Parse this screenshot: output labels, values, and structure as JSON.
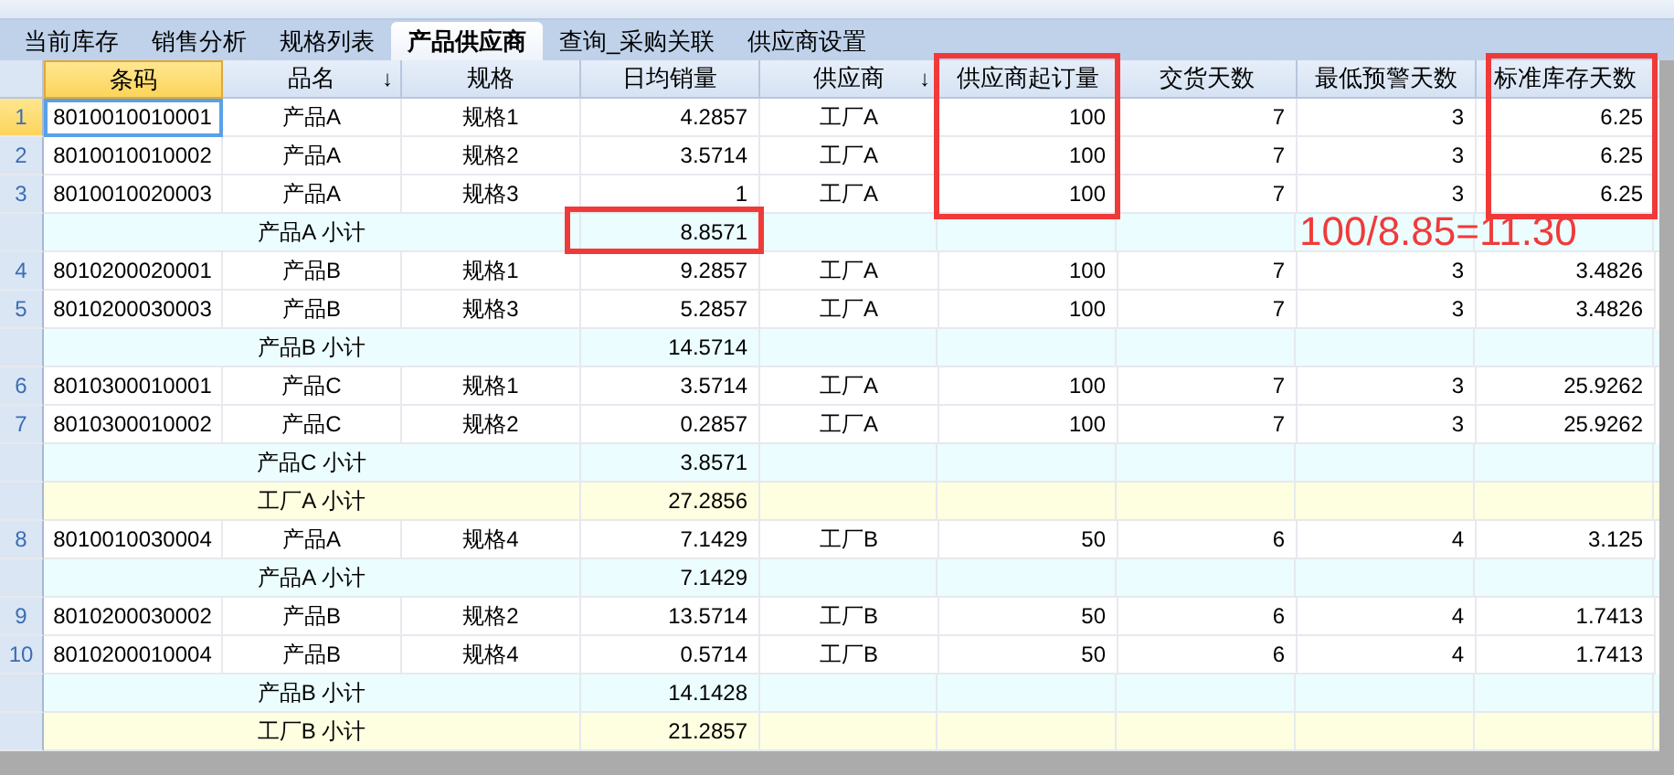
{
  "tabs": [
    {
      "label": "当前库存",
      "selected": false
    },
    {
      "label": "销售分析",
      "selected": false
    },
    {
      "label": "规格列表",
      "selected": false
    },
    {
      "label": "产品供应商",
      "selected": true
    },
    {
      "label": "查询_采购关联",
      "selected": false
    },
    {
      "label": "供应商设置",
      "selected": false
    }
  ],
  "table": {
    "columns": [
      {
        "label": "条码",
        "selected": true
      },
      {
        "label": "品名",
        "selected": false,
        "sort": "↓"
      },
      {
        "label": "规格",
        "selected": false
      },
      {
        "label": "日均销量",
        "selected": false
      },
      {
        "label": "供应商",
        "selected": false,
        "sort": "↓"
      },
      {
        "label": "供应商起订量",
        "selected": false
      },
      {
        "label": "交货天数",
        "selected": false
      },
      {
        "label": "最低预警天数",
        "selected": false
      },
      {
        "label": "标准库存天数",
        "selected": false
      }
    ],
    "rows": [
      {
        "kind": "data",
        "number": "1",
        "selected": true,
        "cells": [
          "8010010010001",
          "产品A",
          "规格1",
          "4.2857",
          "工厂A",
          "100",
          "7",
          "3",
          "6.25"
        ]
      },
      {
        "kind": "data",
        "number": "2",
        "selected": false,
        "cells": [
          "8010010010002",
          "产品A",
          "规格2",
          "3.5714",
          "工厂A",
          "100",
          "7",
          "3",
          "6.25"
        ]
      },
      {
        "kind": "data",
        "number": "3",
        "selected": false,
        "cells": [
          "8010010020003",
          "产品A",
          "规格3",
          "1",
          "工厂A",
          "100",
          "7",
          "3",
          "6.25"
        ]
      },
      {
        "kind": "product_subtotal",
        "label": "产品A 小计",
        "value": "8.8571"
      },
      {
        "kind": "data",
        "number": "4",
        "selected": false,
        "cells": [
          "8010200020001",
          "产品B",
          "规格1",
          "9.2857",
          "工厂A",
          "100",
          "7",
          "3",
          "3.4826"
        ]
      },
      {
        "kind": "data",
        "number": "5",
        "selected": false,
        "cells": [
          "8010200030003",
          "产品B",
          "规格3",
          "5.2857",
          "工厂A",
          "100",
          "7",
          "3",
          "3.4826"
        ]
      },
      {
        "kind": "product_subtotal",
        "label": "产品B 小计",
        "value": "14.5714"
      },
      {
        "kind": "data",
        "number": "6",
        "selected": false,
        "cells": [
          "8010300010001",
          "产品C",
          "规格1",
          "3.5714",
          "工厂A",
          "100",
          "7",
          "3",
          "25.9262"
        ]
      },
      {
        "kind": "data",
        "number": "7",
        "selected": false,
        "cells": [
          "8010300010002",
          "产品C",
          "规格2",
          "0.2857",
          "工厂A",
          "100",
          "7",
          "3",
          "25.9262"
        ]
      },
      {
        "kind": "product_subtotal",
        "label": "产品C 小计",
        "value": "3.8571"
      },
      {
        "kind": "factory_subtotal",
        "label": "工厂A 小计",
        "value": "27.2856"
      },
      {
        "kind": "data",
        "number": "8",
        "selected": false,
        "cells": [
          "8010010030004",
          "产品A",
          "规格4",
          "7.1429",
          "工厂B",
          "50",
          "6",
          "4",
          "3.125"
        ]
      },
      {
        "kind": "product_subtotal",
        "label": "产品A 小计",
        "value": "7.1429"
      },
      {
        "kind": "data",
        "number": "9",
        "selected": false,
        "cells": [
          "8010200030002",
          "产品B",
          "规格2",
          "13.5714",
          "工厂B",
          "50",
          "6",
          "4",
          "1.7413"
        ]
      },
      {
        "kind": "data",
        "number": "10",
        "selected": false,
        "cells": [
          "8010200010004",
          "产品B",
          "规格4",
          "0.5714",
          "工厂B",
          "50",
          "6",
          "4",
          "1.7413"
        ]
      },
      {
        "kind": "product_subtotal",
        "label": "产品B 小计",
        "value": "14.1428"
      },
      {
        "kind": "factory_subtotal",
        "label": "工厂B 小计",
        "value": "21.2857"
      }
    ]
  },
  "annotation": {
    "text": "100/8.85=11.30"
  }
}
